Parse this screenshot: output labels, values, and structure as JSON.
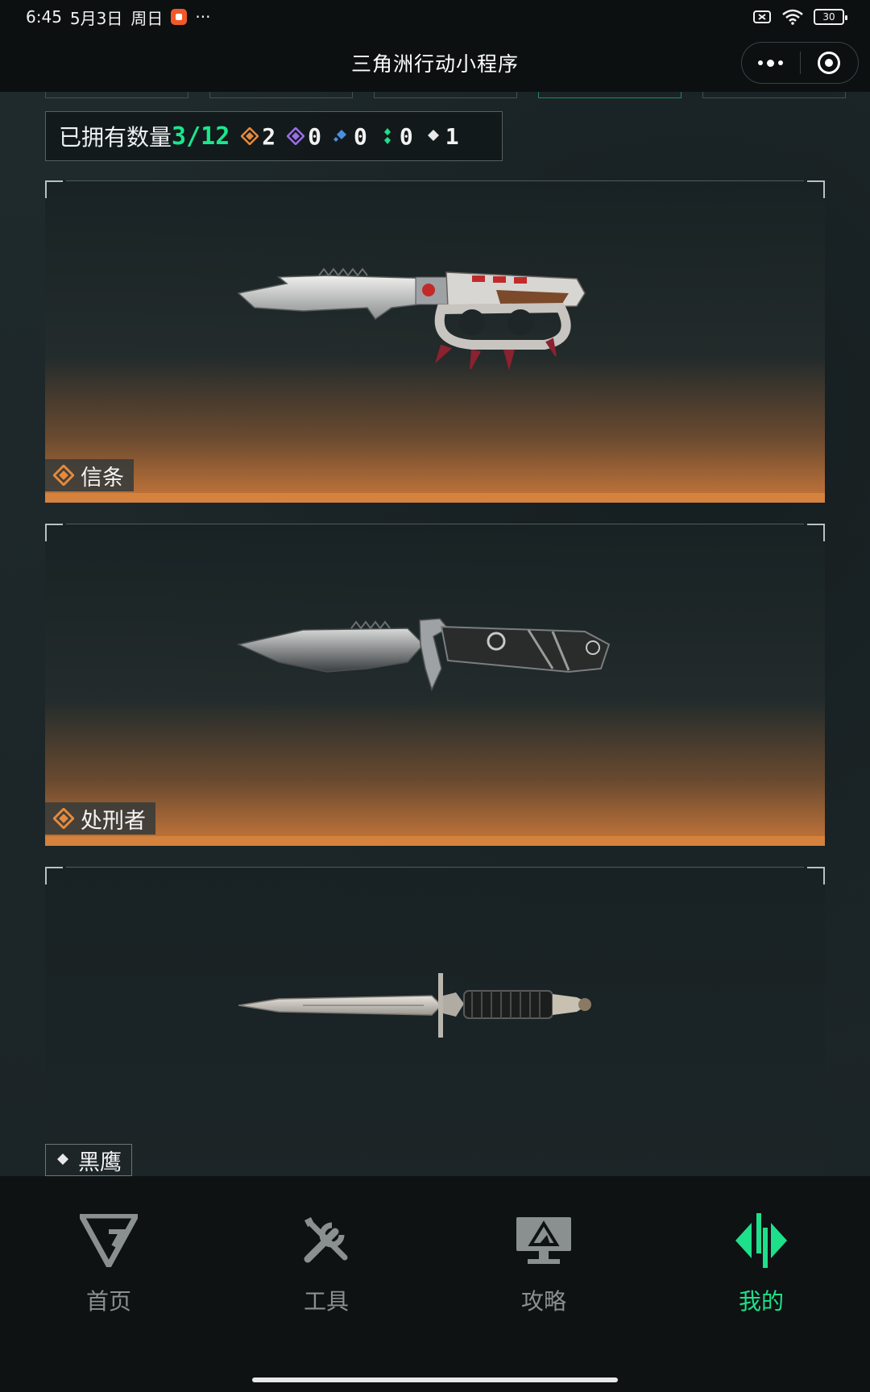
{
  "status_bar": {
    "time": "6:45",
    "date": "5月3日",
    "weekday": "周日",
    "more": "···",
    "battery": "30"
  },
  "title_bar": {
    "title": "三角洲行动小程序"
  },
  "summary": {
    "owned_label": "已拥有数量",
    "owned_value": "3/12",
    "rarities": [
      {
        "count": "2",
        "color": "#e58a3c",
        "icon": "gold-gem-icon"
      },
      {
        "count": "0",
        "color": "#9a6ee8",
        "icon": "purple-gem-icon"
      },
      {
        "count": "0",
        "color": "#4a8fe0",
        "icon": "blue-gem-icon"
      },
      {
        "count": "0",
        "color": "#1ee08a",
        "icon": "green-gem-icon"
      },
      {
        "count": "1",
        "color": "#e8e8e8",
        "icon": "white-gem-icon"
      }
    ]
  },
  "cards": [
    {
      "name": "信条",
      "rarity_color": "#e58a3c",
      "style": "gold"
    },
    {
      "name": "处刑者",
      "rarity_color": "#e58a3c",
      "style": "gold"
    },
    {
      "name": "黑鹰",
      "rarity_color": "#e8e8e8",
      "style": "dark"
    }
  ],
  "nav": {
    "items": [
      {
        "label": "首页",
        "icon": "home-logo-icon",
        "active": false
      },
      {
        "label": "工具",
        "icon": "tools-icon",
        "active": false
      },
      {
        "label": "攻略",
        "icon": "guide-monitor-icon",
        "active": false
      },
      {
        "label": "我的",
        "icon": "profile-logo-icon",
        "active": true
      }
    ]
  },
  "colors": {
    "accent": "#1ee08a",
    "gold": "#e58a3c",
    "background": "#1d2628",
    "nav_background": "#0e1213"
  }
}
